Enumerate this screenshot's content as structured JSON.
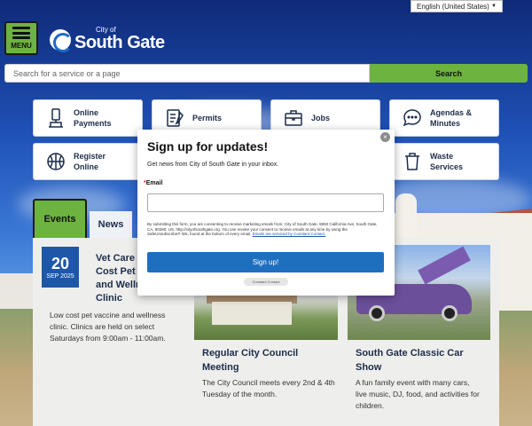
{
  "language": {
    "selected": "English (United States)"
  },
  "header": {
    "menu_label": "MENU",
    "logo_city": "City of",
    "logo_name": "South Gate"
  },
  "search": {
    "placeholder": "Search for a service or a page",
    "button_label": "Search"
  },
  "quick_links": [
    {
      "label_line1": "Online",
      "label_line2": "Payments",
      "icon": "payment-kiosk-icon"
    },
    {
      "label_line1": "Permits",
      "label_line2": "",
      "icon": "checklist-icon"
    },
    {
      "label_line1": "Jobs",
      "label_line2": "",
      "icon": "briefcase-icon"
    },
    {
      "label_line1": "Agendas &",
      "label_line2": "Minutes",
      "icon": "chat-bubble-icon"
    },
    {
      "label_line1": "Register",
      "label_line2": "Online",
      "icon": "basketball-icon"
    },
    {
      "label_line1": "Waste",
      "label_line2": "Services",
      "icon": "trash-can-icon"
    }
  ],
  "tabs": {
    "events": "Events",
    "news": "News"
  },
  "events": [
    {
      "day": "20",
      "month": "SEP 2025",
      "title": "Vet Care Low Cost Pet Vaccine and Wellness Clinic",
      "title_visible": "Vet Care Cost Pet and Welln Clinic",
      "description": "Low cost pet vaccine and wellness clinic. Clinics are held on select Saturdays from 9:00am - 11:00am."
    },
    {
      "title": "Regular City Council Meeting",
      "description": "The City Council meets every 2nd & 4th Tuesday of the month."
    },
    {
      "title": "South Gate Classic Car Show",
      "description": "A fun family event with many cars, live music, DJ, food, and activities for children."
    }
  ],
  "modal": {
    "title": "Sign up for updates!",
    "subtitle": "Get news from City of South Gate in your inbox.",
    "email_label": "Email",
    "required_mark": "*",
    "legal_text": "By submitting this form, you are consenting to receive marketing emails from: City of South Gate, 8650 California Ave, South Gate, CA, 90280, US, http://cityofsouthgate.org. You can revoke your consent to receive emails at any time by using the SafeUnsubscribe® link, found at the bottom of every email.",
    "legal_link": "Emails are serviced by Constant Contact.",
    "signup_label": "Sign up!",
    "close_glyph": "×",
    "badge": "Constant Contact"
  },
  "colors": {
    "accent_green": "#6db33f",
    "brand_blue": "#1f57a8",
    "signup_blue": "#1f6fbf"
  }
}
